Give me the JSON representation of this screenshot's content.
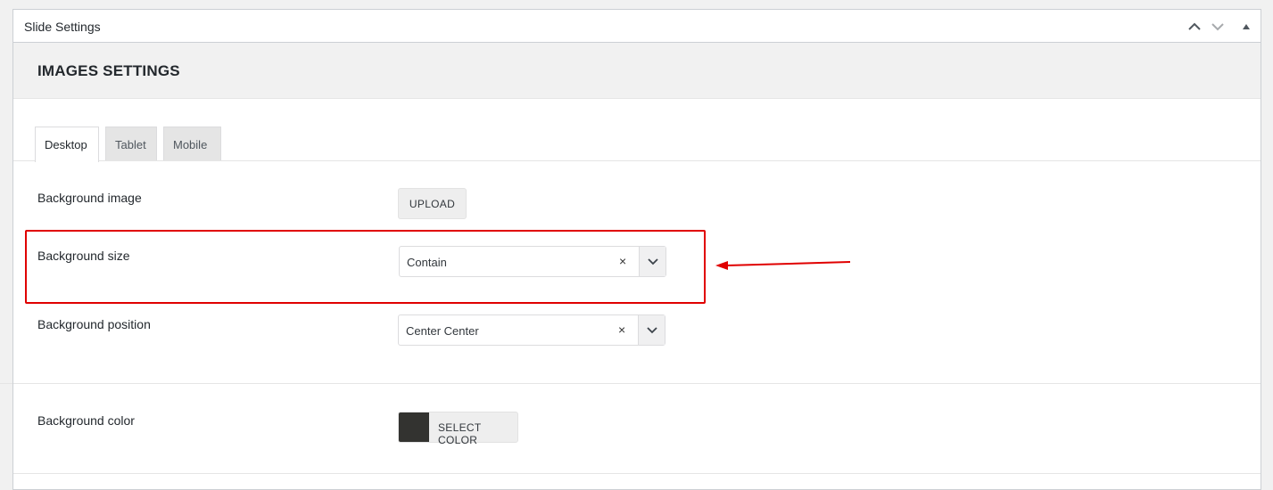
{
  "metabox": {
    "title": "Slide Settings",
    "move_up_icon": "chevron-up-icon",
    "move_down_icon": "chevron-down-icon",
    "toggle_icon": "triangle-up-icon"
  },
  "section": {
    "title": "IMAGES SETTINGS"
  },
  "tabs": [
    {
      "label": "Desktop",
      "active": true
    },
    {
      "label": "Tablet",
      "active": false
    },
    {
      "label": "Mobile",
      "active": false
    }
  ],
  "fields": {
    "background_image": {
      "label": "Background image",
      "button_label": "UPLOAD"
    },
    "background_size": {
      "label": "Background size",
      "value": "Contain",
      "clear": "×"
    },
    "background_position": {
      "label": "Background position",
      "value": "Center Center",
      "clear": "×"
    },
    "background_color": {
      "label": "Background color",
      "button_label": "SELECT COLOR",
      "swatch_color": "#333330"
    }
  },
  "colors": {
    "annotation": "#e00000"
  }
}
